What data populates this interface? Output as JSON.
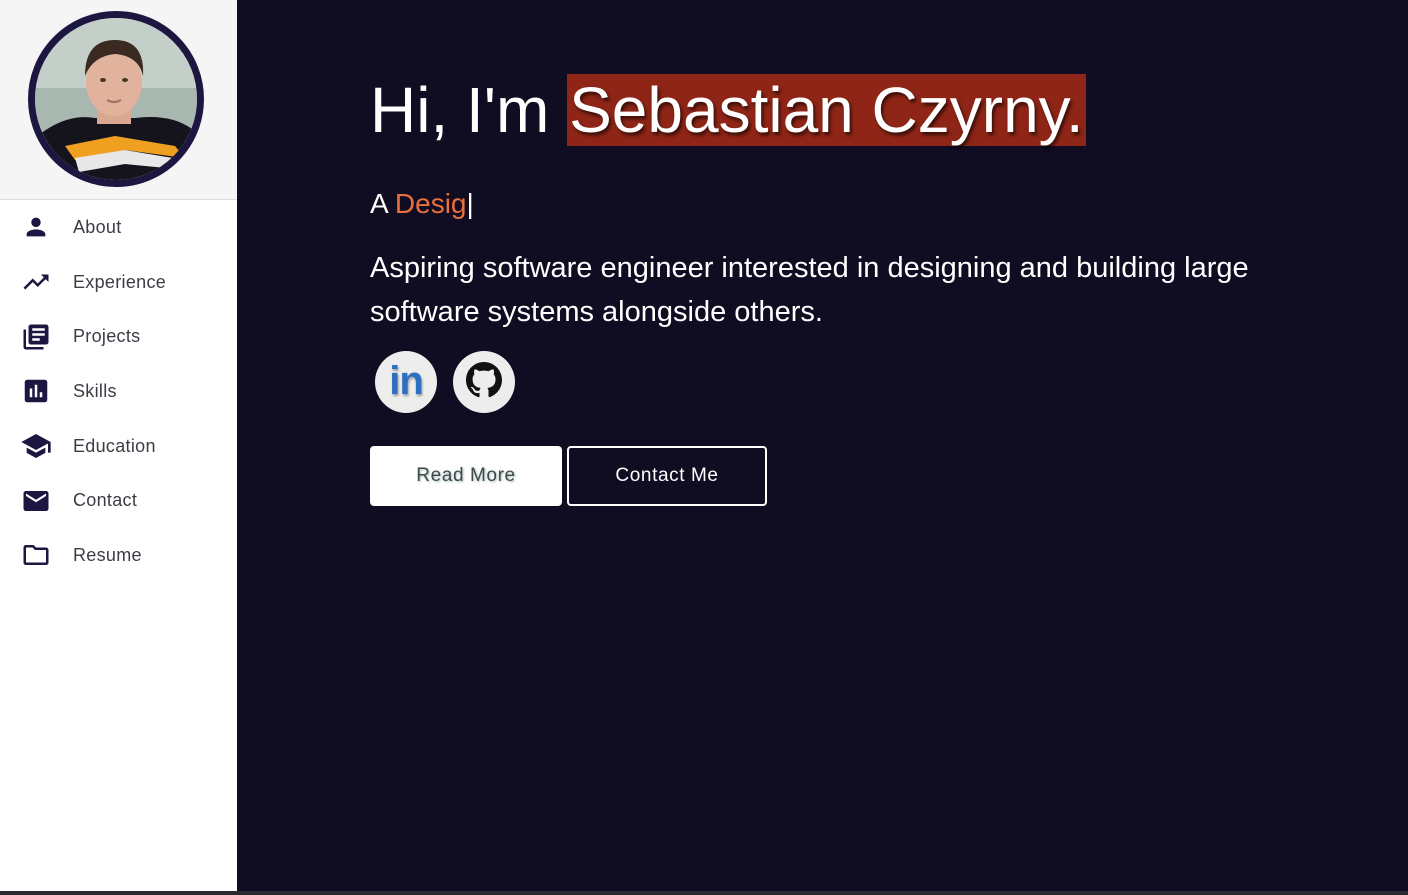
{
  "sidebar": {
    "items": [
      {
        "label": "About",
        "icon": "person-icon"
      },
      {
        "label": "Experience",
        "icon": "trending-up-icon"
      },
      {
        "label": "Projects",
        "icon": "library-books-icon"
      },
      {
        "label": "Skills",
        "icon": "bar-chart-icon"
      },
      {
        "label": "Education",
        "icon": "graduation-cap-icon"
      },
      {
        "label": "Contact",
        "icon": "mail-icon"
      },
      {
        "label": "Resume",
        "icon": "folder-icon"
      }
    ]
  },
  "hero": {
    "greeting": "Hi, I'm ",
    "name": "Sebastian Czyrny.",
    "typing_prefix": "A ",
    "typing_word": "Desig",
    "typing_cursor": "|",
    "tagline": "Aspiring software engineer interested in designing and building large software systems alongside others.",
    "social": {
      "linkedin_text": "in",
      "linkedin_icon": "linkedin-icon",
      "github_icon": "github-icon"
    },
    "buttons": {
      "read_more": "Read More",
      "contact_me": "Contact Me"
    }
  },
  "colors": {
    "background": "#100c22",
    "sidebar": "#ffffff",
    "name_highlight": "#8e2516",
    "typing_accent": "#e8703a",
    "icon": "#1c1640",
    "linkedin_blue": "#2e70c0"
  }
}
